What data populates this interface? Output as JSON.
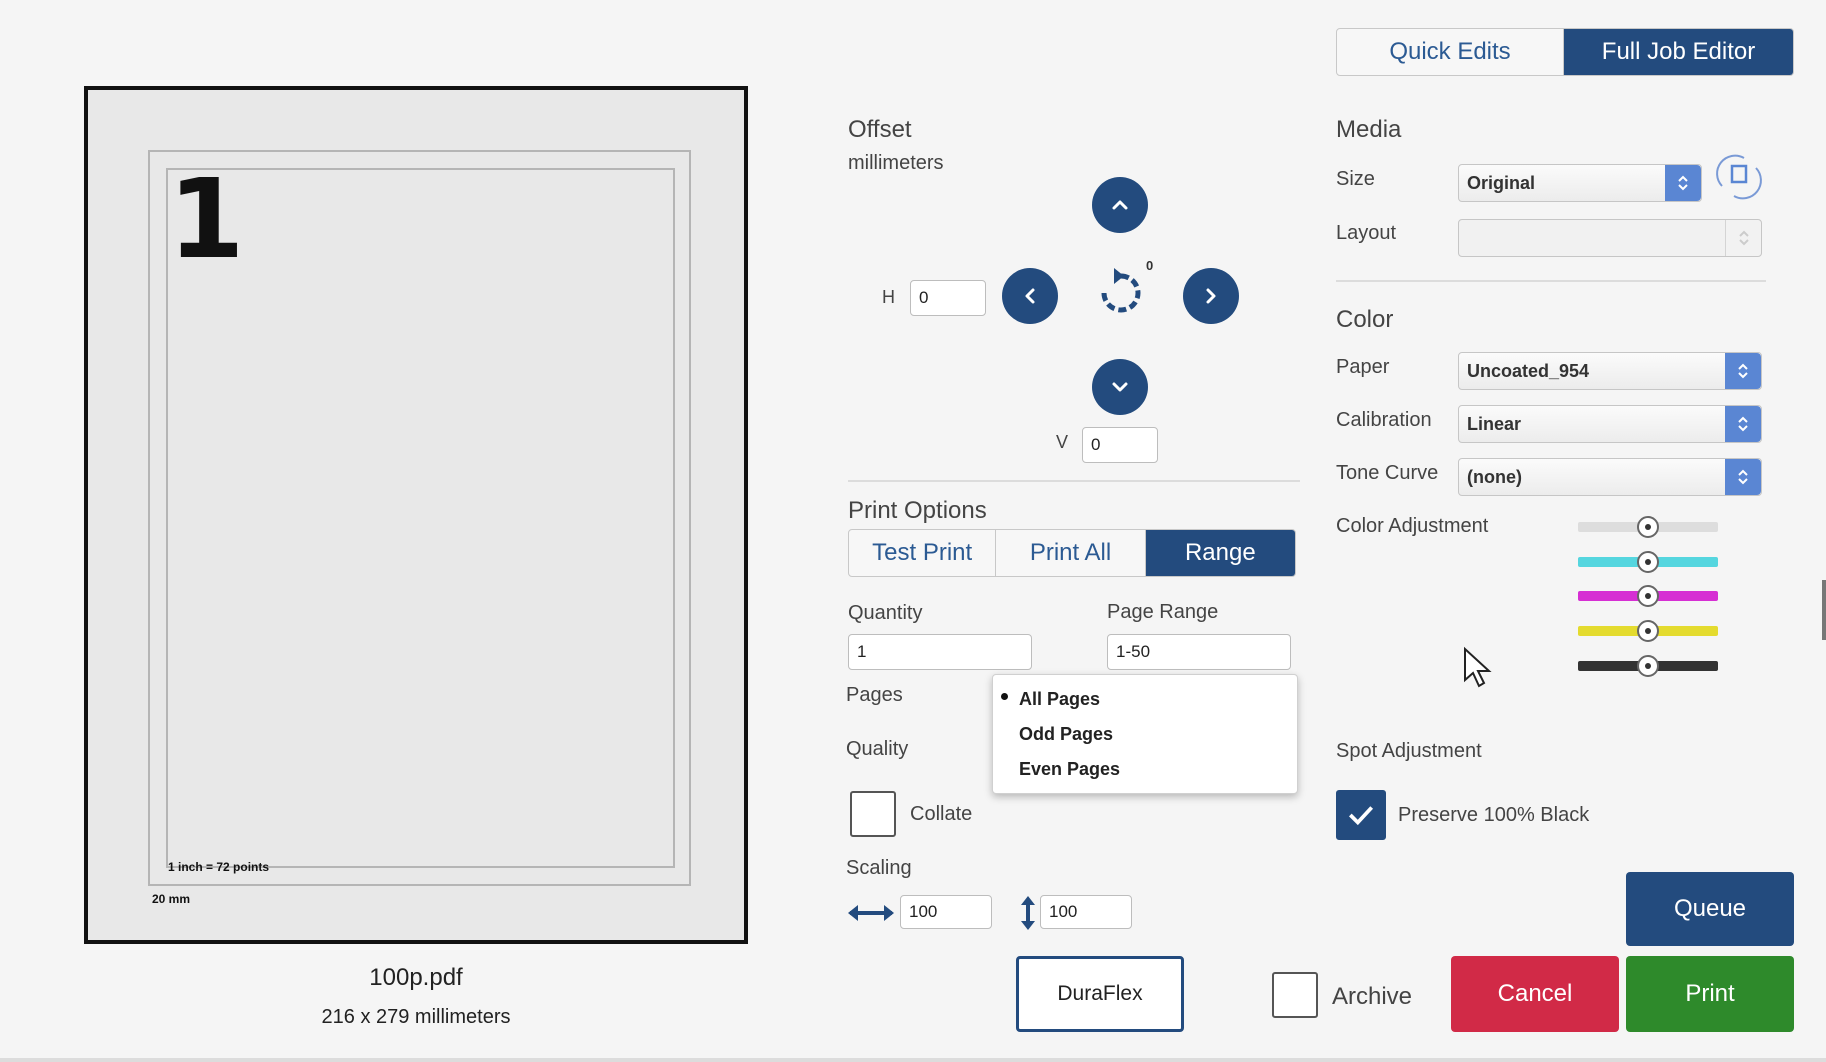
{
  "preview": {
    "page_number": "1",
    "note_points": "1 inch = 72 points",
    "note_mm": "20 mm",
    "file_name": "100p.pdf",
    "file_size": "216 x 279 millimeters"
  },
  "offset": {
    "title": "Offset",
    "unit": "millimeters",
    "h_label": "H",
    "h_value": "0",
    "v_label": "V",
    "v_value": "0",
    "rotation_degree": "0"
  },
  "print_options": {
    "title": "Print Options",
    "modes": [
      "Test Print",
      "Print All",
      "Range"
    ],
    "active_mode": "Range",
    "quantity_label": "Quantity",
    "quantity_value": "1",
    "page_range_label": "Page Range",
    "page_range_value": "1-50",
    "pages_label": "Pages",
    "pages_options": [
      "All Pages",
      "Odd Pages",
      "Even Pages"
    ],
    "pages_selected": "All Pages",
    "quality_label": "Quality",
    "collate_label": "Collate",
    "collate_checked": false,
    "scaling_label": "Scaling",
    "scale_h": "100",
    "scale_v": "100"
  },
  "top_tabs": [
    "Quick Edits",
    "Full Job Editor"
  ],
  "active_top_tab": "Full Job Editor",
  "media": {
    "title": "Media",
    "size_label": "Size",
    "size_value": "Original",
    "layout_label": "Layout",
    "layout_value": ""
  },
  "color": {
    "title": "Color",
    "paper_label": "Paper",
    "paper_value": "Uncoated_954",
    "calibration_label": "Calibration",
    "calibration_value": "Linear",
    "tone_curve_label": "Tone Curve",
    "tone_curve_value": "(none)",
    "adjustment_label": "Color Adjustment",
    "adjustments": [
      {
        "channel": "master",
        "level": 0.5,
        "color": "#dddddd"
      },
      {
        "channel": "cyan",
        "level": 0.5,
        "color": "#55d6df"
      },
      {
        "channel": "magenta",
        "level": 0.5,
        "color": "#d62fd3"
      },
      {
        "channel": "yellow",
        "level": 0.5,
        "color": "#e4db2e"
      },
      {
        "channel": "black",
        "level": 0.5,
        "color": "#333333"
      }
    ],
    "spot_label": "Spot Adjustment",
    "preserve_black_label": "Preserve 100% Black",
    "preserve_black_checked": true
  },
  "actions": {
    "duraflex": "DuraFlex",
    "archive_label": "Archive",
    "archive_checked": false,
    "queue": "Queue",
    "cancel": "Cancel",
    "print": "Print"
  },
  "colors": {
    "primary": "#234b7e",
    "cancel": "#d12a47",
    "print": "#2e8a2b",
    "select_arrow": "#5a86d3"
  }
}
